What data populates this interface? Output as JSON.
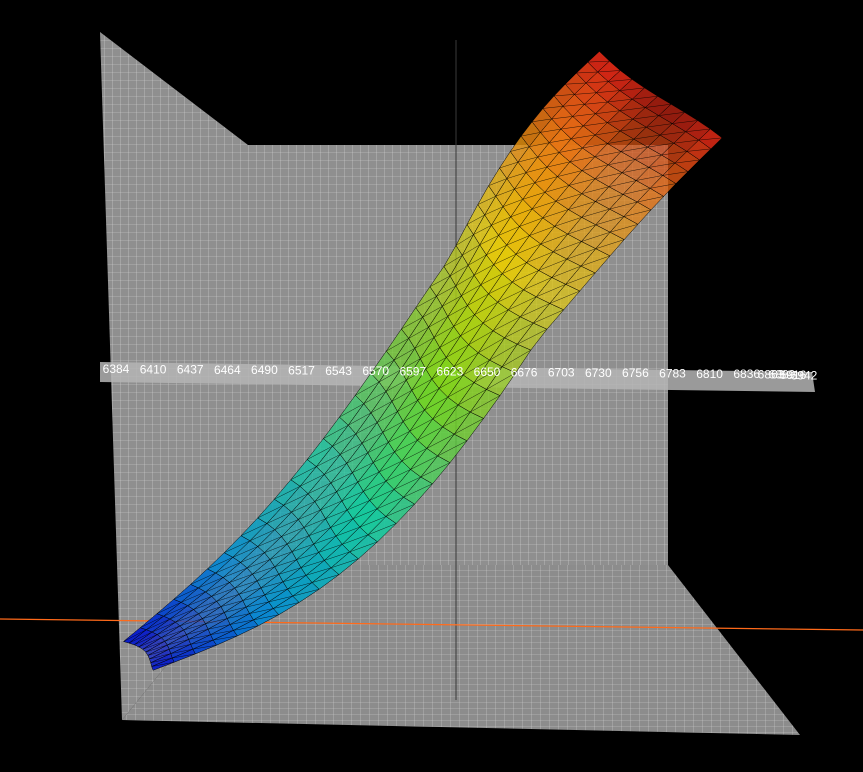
{
  "chart_data": {
    "type": "surface",
    "title": "",
    "xlabel": "",
    "ylabel": "",
    "zlabel": "",
    "x_ticks": [
      "6384",
      "6410",
      "6437",
      "6464",
      "6490",
      "6517",
      "6543",
      "6570",
      "6597",
      "6623",
      "6650",
      "6676",
      "6703",
      "6730",
      "6756",
      "6783",
      "6810",
      "6836",
      "6863",
      "6889",
      "6916",
      "6942"
    ],
    "x_range": [
      6384,
      6942
    ],
    "z_range": [
      0,
      1
    ],
    "background": "#000000",
    "panel_color": "#8f8f8f",
    "grid_color": "#cfcfcf",
    "mesh_color": "#000000",
    "colormap": [
      "#0a14c8",
      "#0a8ad0",
      "#14c8a0",
      "#78d21e",
      "#e6c80a",
      "#e67814",
      "#cd1e14"
    ],
    "guide_line_color": "#ff6a1a",
    "surface_profile": {
      "x": [
        6384,
        6410,
        6437,
        6464,
        6490,
        6517,
        6543,
        6570,
        6597,
        6623,
        6650,
        6676,
        6703,
        6730,
        6756,
        6783,
        6810,
        6836
      ],
      "z": [
        0.02,
        0.06,
        0.12,
        0.19,
        0.26,
        0.33,
        0.4,
        0.46,
        0.52,
        0.58,
        0.64,
        0.7,
        0.76,
        0.82,
        0.88,
        0.93,
        0.97,
        1.0
      ]
    }
  }
}
